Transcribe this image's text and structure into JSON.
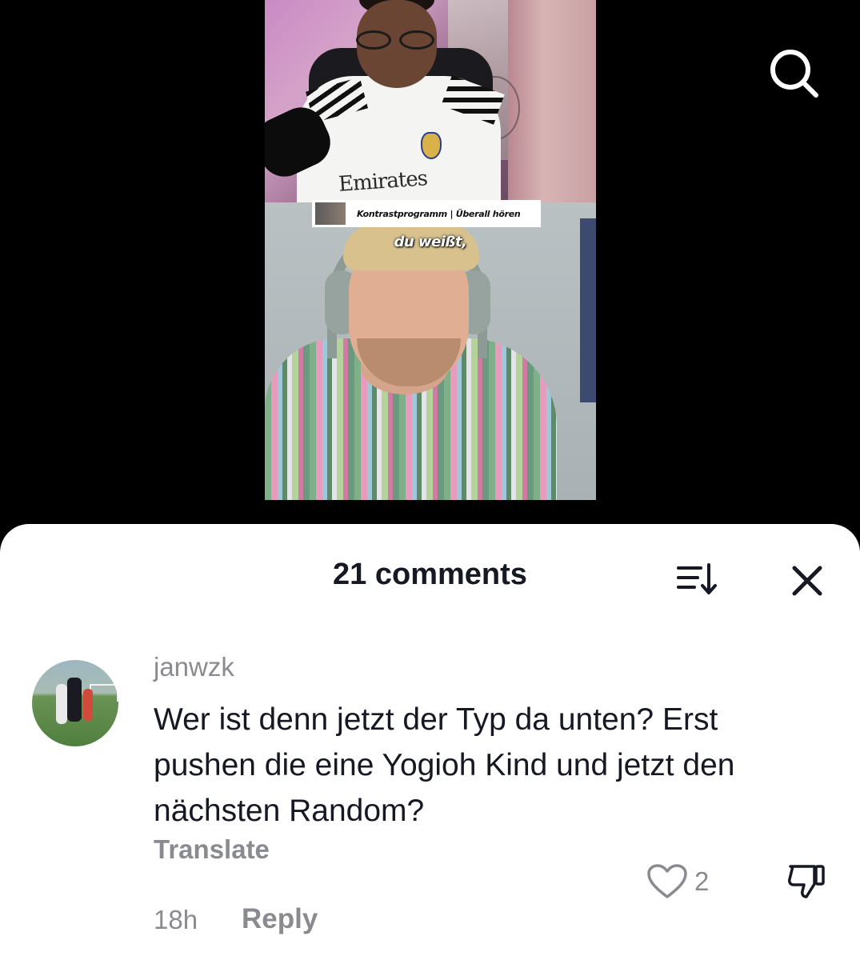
{
  "video": {
    "banner_text": "Kontrastprogramm | Überall hören",
    "caption": "du weißt,",
    "jersey_sponsor": "Emirates"
  },
  "top_bar": {
    "search_icon": "search-icon"
  },
  "comments_sheet": {
    "title": "21 comments",
    "sort_icon": "sort-icon",
    "close_icon": "close-icon"
  },
  "comment": {
    "username": "janwzk",
    "text": "Wer ist denn jetzt der Typ da unten? Erst pushen die eine Yogioh Kind und jetzt den nächsten Random?",
    "translate_label": "Translate",
    "timestamp": "18h",
    "reply_label": "Reply",
    "like_count": "2",
    "like_icon": "heart-outline-icon",
    "dislike_icon": "thumbs-down-icon"
  },
  "colors": {
    "background": "#000000",
    "sheet": "#ffffff",
    "primary_text": "#161823",
    "secondary_text": "#8a8b91"
  }
}
